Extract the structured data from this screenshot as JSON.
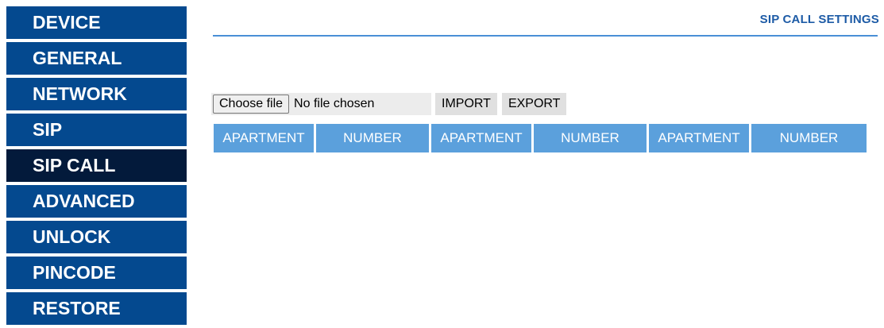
{
  "sidebar": {
    "items": [
      {
        "label": "DEVICE"
      },
      {
        "label": "GENERAL"
      },
      {
        "label": "NETWORK"
      },
      {
        "label": "SIP"
      },
      {
        "label": "SIP CALL"
      },
      {
        "label": "ADVANCED"
      },
      {
        "label": "UNLOCK"
      },
      {
        "label": "PINCODE"
      },
      {
        "label": "RESTORE"
      }
    ],
    "active_item": "SIP CALL"
  },
  "page": {
    "title": "SIP CALL SETTINGS"
  },
  "file_input": {
    "button_label": "Choose file",
    "status_text": "No file chosen"
  },
  "actions": {
    "import_label": "IMPORT",
    "export_label": "EXPORT"
  },
  "table": {
    "columns": [
      "APARTMENT",
      "NUMBER",
      "APARTMENT",
      "NUMBER",
      "APARTMENT",
      "NUMBER"
    ]
  },
  "colors": {
    "nav_bg": "#04498f",
    "nav_active_bg": "#031a3b",
    "header_bg": "#5ba0dc",
    "title_color": "#1d5ba6"
  }
}
